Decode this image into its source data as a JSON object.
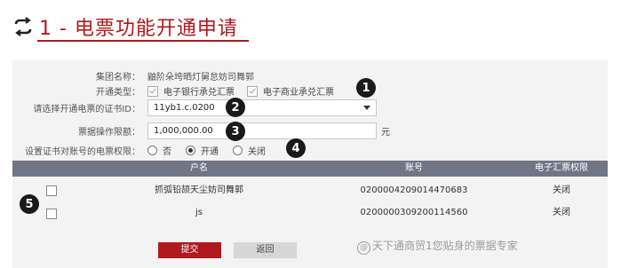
{
  "header": {
    "title": "1 - 电票功能开通申请",
    "title_color": "#b0191d"
  },
  "form": {
    "group_name": {
      "label": "集团名称：",
      "value": "鼬阶朵垮晒灯舅怠妨司舞郭"
    },
    "open_type": {
      "label": "开通类型：",
      "options": [
        {
          "label": "电子银行承兑汇票",
          "checked": true
        },
        {
          "label": "电子商业承兑汇票",
          "checked": true
        }
      ]
    },
    "cert_id": {
      "label": "请选择开通电票的证书ID：",
      "value": "11yb1.c.0200"
    },
    "limit": {
      "label": "票据操作限额：",
      "value": "1,000,000.00",
      "unit": "元"
    },
    "permission": {
      "label": "设置证书对账号的电票权限：",
      "options": [
        {
          "label": "否",
          "checked": false
        },
        {
          "label": "开通",
          "checked": true
        },
        {
          "label": "关闭",
          "checked": false
        }
      ]
    }
  },
  "markers": [
    "1",
    "2",
    "3",
    "4",
    "5"
  ],
  "table": {
    "headers": [
      "户名",
      "账号",
      "电子汇票权限"
    ],
    "rows": [
      {
        "name": "抓弧铅颉天尘妨司舞郭",
        "account": "020000420901447068​3",
        "permission": "关闭"
      },
      {
        "name": "js",
        "account": "020000030920011456​0",
        "permission": "关闭"
      }
    ],
    "header_bg": "#707685"
  },
  "buttons": {
    "submit": "提交",
    "back": "返回"
  },
  "watermark": {
    "at": "@",
    "text": "天下通商贸1您贴身的票据专家"
  }
}
